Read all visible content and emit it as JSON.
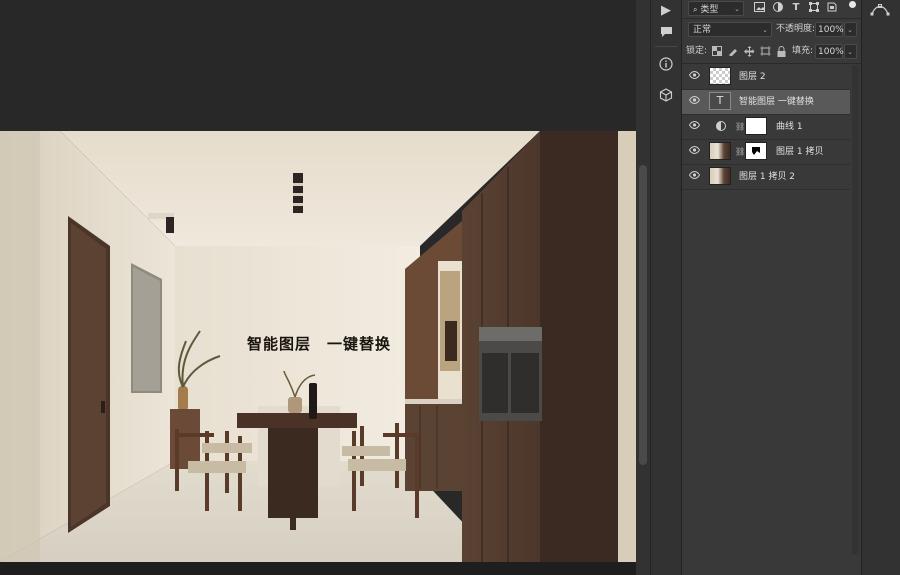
{
  "canvas": {
    "overlay_text": "智能图层　一键替换"
  },
  "tools": [
    {
      "name": "play-icon",
      "glyph": "▶"
    },
    {
      "name": "comment-icon",
      "glyph": "💬"
    },
    {
      "name": "info-icon",
      "glyph": "ⓘ"
    },
    {
      "name": "3d-cube-icon",
      "glyph": "⬡"
    }
  ],
  "layers_panel": {
    "filter": {
      "label": "类型",
      "icons": [
        "image-filter-icon",
        "adjustment-filter-icon",
        "text-filter-icon",
        "shape-filter-icon",
        "smartobject-filter-icon"
      ]
    },
    "blend_mode": "正常",
    "opacity_label": "不透明度:",
    "opacity_value": "100%",
    "lock_label": "锁定:",
    "fill_label": "填充:",
    "fill_value": "100%",
    "layers": [
      {
        "name": "图层 2",
        "thumb": "transparent",
        "selected": false
      },
      {
        "name": "智能图层  一键替换",
        "thumb": "text",
        "selected": true
      },
      {
        "name": "曲线 1",
        "thumb": "adjustment",
        "selected": false
      },
      {
        "name": "图层 1 拷贝",
        "thumb": "photo-mask",
        "selected": false
      },
      {
        "name": "图层 1 拷贝 2",
        "thumb": "photo",
        "selected": false
      }
    ]
  },
  "colors": {
    "panel_bg": "#393939",
    "selected_layer": "#595959",
    "workspace": "#282828"
  }
}
